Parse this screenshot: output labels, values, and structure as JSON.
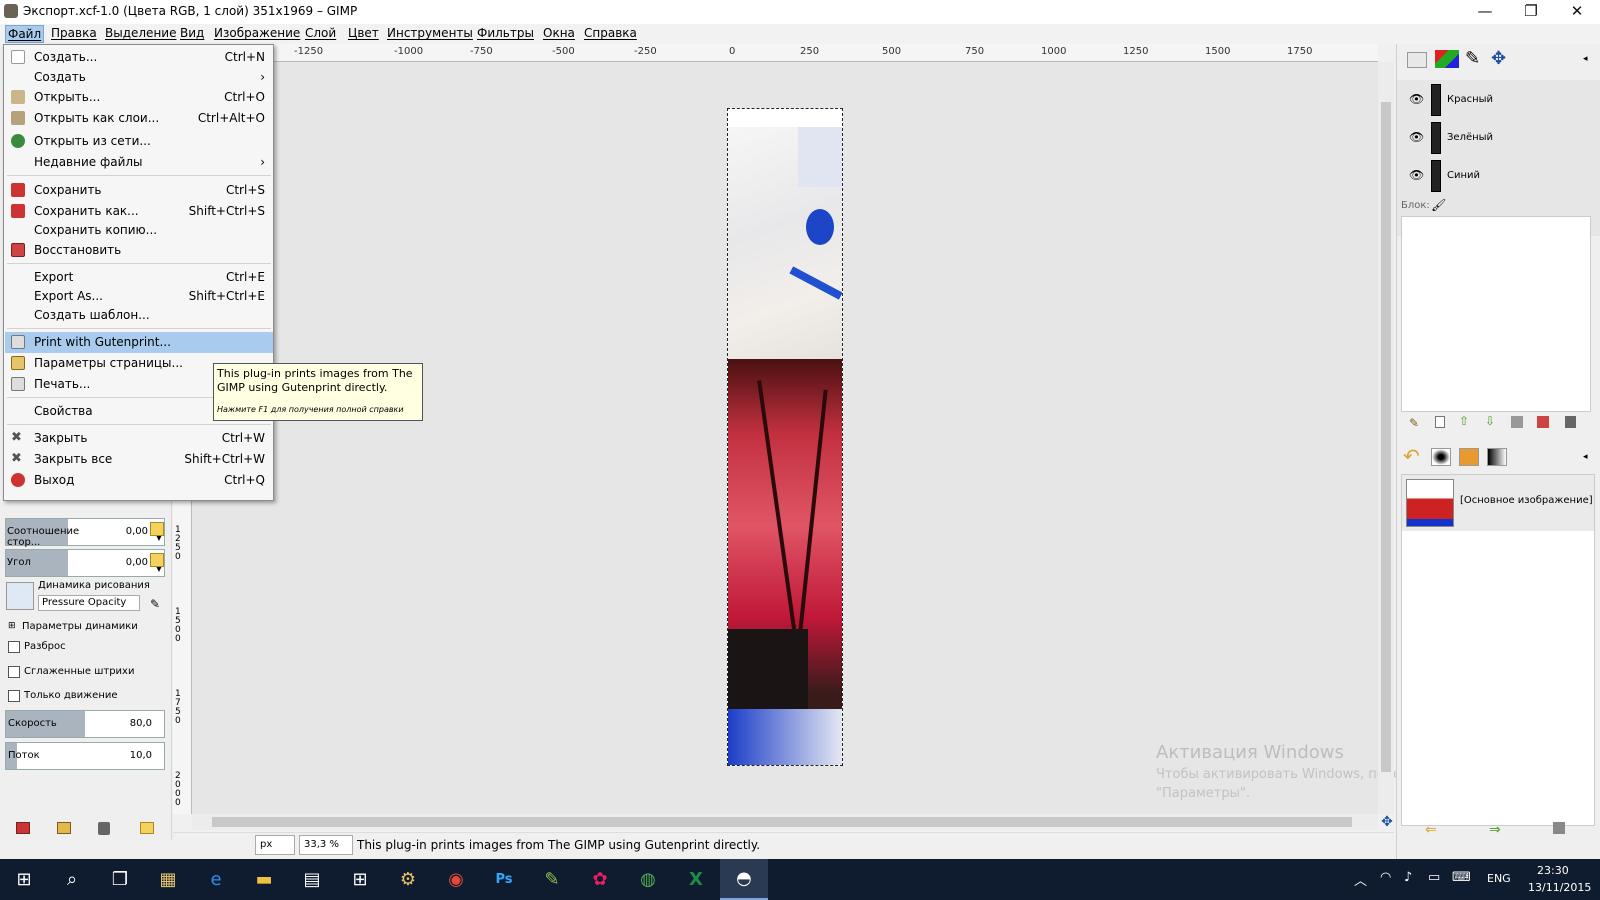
{
  "window": {
    "title": "Экспорт.xcf-1.0 (Цвета RGB, 1 слой) 351x1969 – GIMP",
    "minimize": "—",
    "maximize": "❐",
    "close": "✕"
  },
  "menubar": [
    "Файл",
    "Правка",
    "Выделение",
    "Вид",
    "Изображение",
    "Слой",
    "Цвет",
    "Инструменты",
    "Фильтры",
    "Окна",
    "Справка"
  ],
  "file_menu": [
    {
      "label": "Создать...",
      "accel": "Ctrl+N",
      "icon": "new-document-icon"
    },
    {
      "label": "Создать",
      "accel": "",
      "submenu": "›"
    },
    {
      "label": "Открыть...",
      "accel": "Ctrl+O",
      "icon": "open-folder-icon"
    },
    {
      "label": "Открыть как слои...",
      "accel": "Ctrl+Alt+O",
      "icon": "open-as-layers-icon"
    },
    {
      "label": "Открыть из сети...",
      "accel": "",
      "icon": "globe-icon"
    },
    {
      "label": "Недавние файлы",
      "accel": "",
      "submenu": "›"
    },
    {
      "label": "Сохранить",
      "accel": "Ctrl+S",
      "icon": "save-icon"
    },
    {
      "label": "Сохранить как...",
      "accel": "Shift+Ctrl+S",
      "icon": "save-as-icon"
    },
    {
      "label": "Сохранить копию...",
      "accel": ""
    },
    {
      "label": "Восстановить",
      "accel": "",
      "icon": "revert-icon"
    },
    {
      "label": "Export",
      "accel": "Ctrl+E"
    },
    {
      "label": "Export As...",
      "accel": "Shift+Ctrl+E"
    },
    {
      "label": "Создать шаблон...",
      "accel": ""
    },
    {
      "label": "Print with Gutenprint...",
      "accel": "",
      "icon": "printer-icon"
    },
    {
      "label": "Параметры страницы...",
      "accel": "",
      "icon": "page-setup-icon"
    },
    {
      "label": "Печать...",
      "accel": "",
      "icon": "print-icon"
    },
    {
      "label": "Свойства",
      "accel": ""
    },
    {
      "label": "Закрыть",
      "accel": "Ctrl+W",
      "icon": "close-x-icon"
    },
    {
      "label": "Закрыть все",
      "accel": "Shift+Ctrl+W",
      "icon": "close-all-icon"
    },
    {
      "label": "Выход",
      "accel": "Ctrl+Q",
      "icon": "quit-icon"
    }
  ],
  "tooltip": {
    "text": "This plug-in prints images from The GIMP using Gutenprint directly.",
    "hint": "Нажмите F1 для получения полной справки"
  },
  "tool_options": {
    "aspect_label": "Соотношение стор...",
    "aspect_value": "0,00",
    "angle_label": "Угол",
    "angle_value": "0,00",
    "dynamics_label": "Динамика рисования",
    "dynamics_value": "Pressure Opacity",
    "dynamics_params": "Параметры динамики",
    "scatter": "Разброс",
    "smooth": "Сглаженные штрихи",
    "motion_only": "Только движение",
    "speed_label": "Скорость",
    "speed_value": "80,0",
    "speed_fill": 0.5,
    "flow_label": "Поток",
    "flow_value": "10,0",
    "flow_fill": 0.07
  },
  "ruler": {
    "h_ticks": [
      "-1250",
      "-1000",
      "-750",
      "-500",
      "-250",
      "0",
      "250",
      "500",
      "750",
      "1000",
      "1250",
      "1500",
      "1750"
    ],
    "v_ticks": [
      "1250",
      "1500",
      "1750",
      "2000"
    ]
  },
  "statusbar": {
    "unit": "px",
    "zoom": "33,3 %",
    "message": "This plug-in prints images from The GIMP using Gutenprint directly."
  },
  "watermark": {
    "title": "Активация Windows",
    "line1": "Чтобы активировать Windows, перейдите в раздел",
    "line2": "\"Параметры\"."
  },
  "channels": [
    {
      "name": "Красный"
    },
    {
      "name": "Зелёный"
    },
    {
      "name": "Синий"
    }
  ],
  "lock_label": "Блок:",
  "history": {
    "item": "[Основное изображение]"
  },
  "taskbar": {
    "lang": "ENG",
    "time": "23:30",
    "date": "13/11/2015"
  },
  "colors": {
    "menu_highlight": "#a8cbee",
    "tooltip_bg": "#ffffe1",
    "taskbar": "#0f1b2e"
  }
}
